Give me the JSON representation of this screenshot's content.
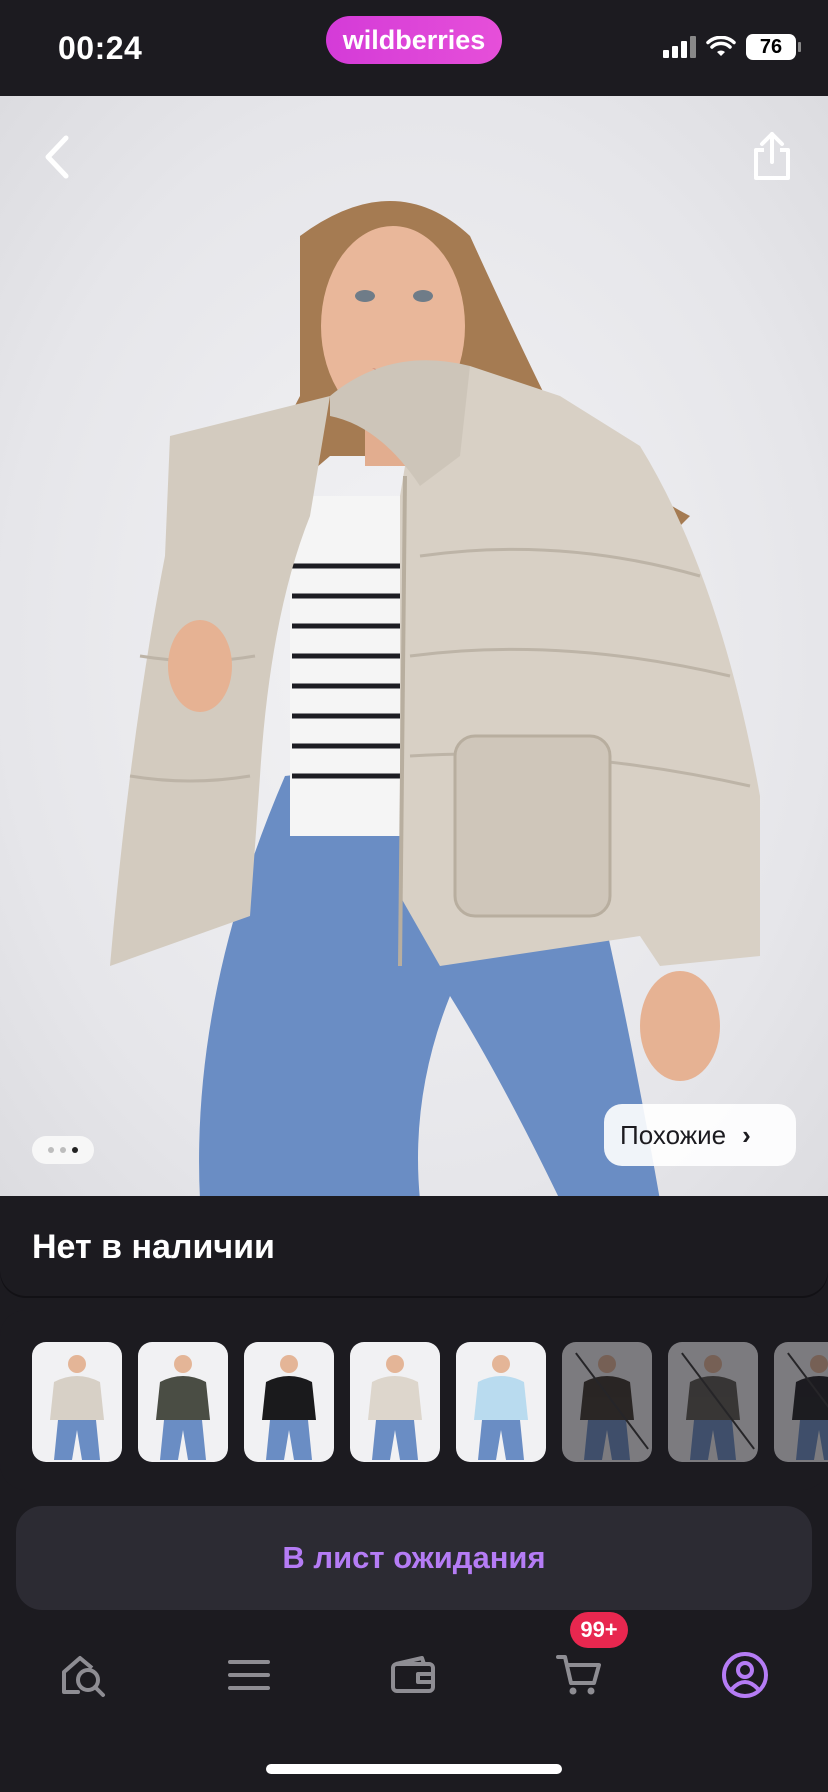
{
  "status_bar": {
    "time": "00:24",
    "brand": "wildberries",
    "battery": "76"
  },
  "photo": {
    "similar_label": "Похожие",
    "gallery_dots": 3,
    "active_dot_index": 2
  },
  "product": {
    "stock_status": "Нет в наличии"
  },
  "variants": [
    {
      "name": "variant-1",
      "color": "#d7d0c6",
      "available": true
    },
    {
      "name": "variant-2",
      "color": "#4a4d44",
      "available": true
    },
    {
      "name": "variant-3",
      "color": "#1a1a1c",
      "available": true
    },
    {
      "name": "variant-4",
      "color": "#ddd6cc",
      "available": true
    },
    {
      "name": "variant-5",
      "color": "#b9dbef",
      "available": true
    },
    {
      "name": "variant-6",
      "color": "#3b342c",
      "available": false
    },
    {
      "name": "variant-7",
      "color": "#5a5850",
      "available": false
    },
    {
      "name": "variant-8",
      "color": "#1e1e22",
      "available": false
    }
  ],
  "actions": {
    "wait_list_label": "В лист ожидания"
  },
  "bottom_nav": {
    "items": [
      "search",
      "catalog",
      "wallet",
      "cart",
      "profile"
    ],
    "cart_badge": "99+",
    "active_color": "#b57cf5",
    "inactive_color": "#8e8d93"
  },
  "colors": {
    "accent": "#b57cf5",
    "badge": "#e8274f",
    "brand": "#e64fd9",
    "background": "#1c1b20"
  }
}
